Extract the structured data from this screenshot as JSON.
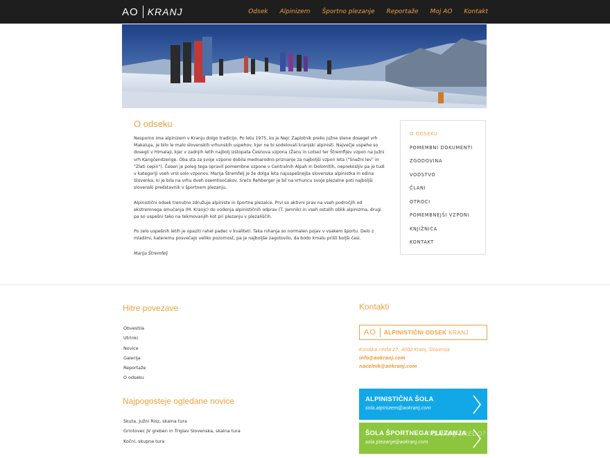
{
  "header": {
    "logo_ao": "AO",
    "logo_text": "KRANJ",
    "nav": [
      "Odsek",
      "Alpinizem",
      "Športno plezanje",
      "Reportaže",
      "Moj AO",
      "Kontakt"
    ]
  },
  "main": {
    "title": "O odseku",
    "paragraphs": [
      "Nesporno ima alpinizem v Kranju dolgo tradicijo. Po letu 1975, ko je Nejc Zaplotnik preko južne stene dosegel vrh Makaluja, je bilo le malo slovenskih vrhunskih uspehov, kjer ne bi sodelovali kranjski alpinisti. Največje uspehe so dosegli v Himalaji, kjer v zadnjih letih najbolj izstopata Česnova vzpona (Žanu in Lotse) ter Štremfljev vzpon na Južni vrh Kangčendzenge. Oba sta za svoje vzpone dobila mednarodno priznanje za najboljši vzpon leta (\"Snežni lev\" in \"Zlati cepin\"). Česen je poleg tega opravil pomembne vzpone v Centralnih Alpah in Dolomitih, neprekosljiv pa je tudi v kategoriji vseh vrst solo vzponov. Marija Štremfelj je že dolga leta najuspešnejša slovenska alpinistka in edina Slovenka, ki je bila na vrhu dveh osemtisočakov. Srečo Rehberger je bil na vrhuncu svoje plezalne poti najboljši slovenski predstavnik v športnem plezanju.",
      "Alpinistični odsek trenutno združuje alpiniste in športne plezalce. Prvi so aktivni prav na vseh področjih od ekstremnega smučanja (M. Kranjc) do vodenja alpinističnih odprav (T. Jamnik) in vseh ostalih oblik alpinizma, drugi pa so uspešni tako na tekmovanjih kot pri plezanju v plezališčih.",
      "Po zelo uspešnih letih je opaziti rahel padec v kvaliteti. Taka nihanja so normalen pojav v vsakem športu. Delo z mladimi, kateremu posvečajo veliko pozornost, pa je najboljše zagotovilo, da bodo kmalu prišli boljši časi."
    ],
    "signature": "Marija Štremfelj"
  },
  "sidebar": {
    "items": [
      "O ODSEKU",
      "POMEMBNI DOKUMENTI",
      "ZGODOVINA",
      "VODSTVO",
      "ČLANI",
      "OTROCI",
      "POMEMBNEJŠI VZPONI",
      "KNJIŽNICA",
      "KONTAKT"
    ]
  },
  "footer": {
    "quick_links_title": "Hitre povezave",
    "quick_links": [
      "Obvestila",
      "Utrinki",
      "Novice",
      "Galerija",
      "Reportaže",
      "O odseku"
    ],
    "popular_title": "Najpogosteje ogledane novice",
    "popular": [
      "Skuta, Južni Risz, skalna tura",
      "Grintovec JV greben in Triglav Slovenska, skalna tura",
      "Kočni, skupna tura"
    ],
    "contact_title": "Kontakti",
    "brand_ao": "AO",
    "brand_name": "ALPINISTIČNI ODSEK",
    "brand_city": "KRANJ",
    "address": "Koroška cesta 27, 4000 Kranj, Slovenija",
    "email1": "info@aokranj.com",
    "email2": "nacelnik@aokranj.com",
    "school1_title": "ALPINISTIČNA ŠOLA",
    "school1_email": "sola.alpinizem@aokranj.com",
    "school2_title": "ŠOLA ŠPORTNEGA PLEZANJA",
    "school2_email": "sola.plezanje@aokranj.com",
    "ghost_text": "TRENIRAJ GREDO?"
  },
  "colors": {
    "accent": "#f0a040",
    "topbar": "#1e1e1e",
    "cta_blue": "#12a8e8",
    "cta_green": "#8cc63f"
  }
}
